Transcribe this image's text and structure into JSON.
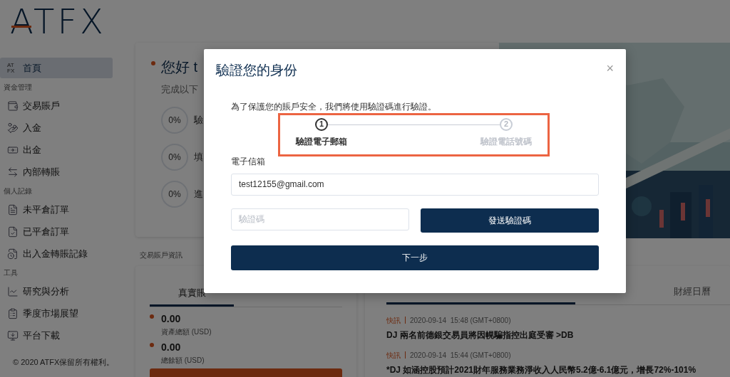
{
  "logo": {
    "text": "ATFX"
  },
  "sidebar": {
    "items": [
      {
        "kind": "item",
        "label": "首頁",
        "icon_lines": [
          "AT",
          "FX"
        ],
        "selected": true
      },
      {
        "kind": "header",
        "label": "資金管理"
      },
      {
        "kind": "item",
        "label": "交易賬戶",
        "selected": false
      },
      {
        "kind": "item",
        "label": "入金",
        "selected": false
      },
      {
        "kind": "item",
        "label": "出金",
        "selected": false
      },
      {
        "kind": "item",
        "label": "內部轉賬",
        "selected": false
      },
      {
        "kind": "header",
        "label": "個人記錄"
      },
      {
        "kind": "item",
        "label": "未平倉訂單",
        "selected": false
      },
      {
        "kind": "item",
        "label": "已平倉訂單",
        "selected": false
      },
      {
        "kind": "item",
        "label": "出入金轉賬記錄",
        "selected": false
      },
      {
        "kind": "header",
        "label": "工具"
      },
      {
        "kind": "item",
        "label": "研究與分析",
        "selected": false
      },
      {
        "kind": "item",
        "label": "季度市場展望",
        "selected": false
      },
      {
        "kind": "item",
        "label": "平台下載",
        "selected": false
      }
    ],
    "footer": "© 2020 ATFX保留所有權利。"
  },
  "greeting": {
    "title": "您好 t",
    "subtitle": "完成以下",
    "tasks": [
      {
        "percent": "0%",
        "label": "驗"
      },
      {
        "percent": "0%",
        "label": "填"
      },
      {
        "percent": "0%",
        "label": "進"
      }
    ]
  },
  "account_info": {
    "heading": "交易賬戶資訊",
    "tabs": [
      {
        "label": "真實賬",
        "selected": true
      }
    ],
    "balances": [
      {
        "value": "0.00",
        "label": "資產總額 (USD)"
      },
      {
        "value": "0.00",
        "label": "總餘額 (USD)"
      }
    ]
  },
  "news": {
    "tabs": [
      {
        "label": "財經日曆",
        "selected": false
      }
    ],
    "items": [
      {
        "tag": "快訊",
        "time": "2020-09-14  15:48 (GMT+0800)",
        "headline": "DJ 兩名前德銀交易員將因幌騙指控出庭受審 >DB"
      },
      {
        "tag": "快訊",
        "time": "2020-09-14  15:44 (GMT+0800)",
        "headline": "*DJ 如涵控股預計2021財年服務業務淨收入人民幣5.2億-6.1億元，增長72%-101%"
      }
    ]
  },
  "modal": {
    "title": "驗證您的身份",
    "close": "×",
    "description": "為了保護您的賬戶安全，我們將使用驗證碼進行驗證。",
    "steps": [
      {
        "number": "1",
        "label": "驗證電子郵箱",
        "selected": true
      },
      {
        "number": "2",
        "label": "驗證電話號碼",
        "selected": false
      }
    ],
    "email": {
      "label": "電子信箱",
      "value": "test12155@gmail.com"
    },
    "code": {
      "placeholder": "驗證碼"
    },
    "send_button": "發送驗證碼",
    "next_button": "下一步"
  }
}
